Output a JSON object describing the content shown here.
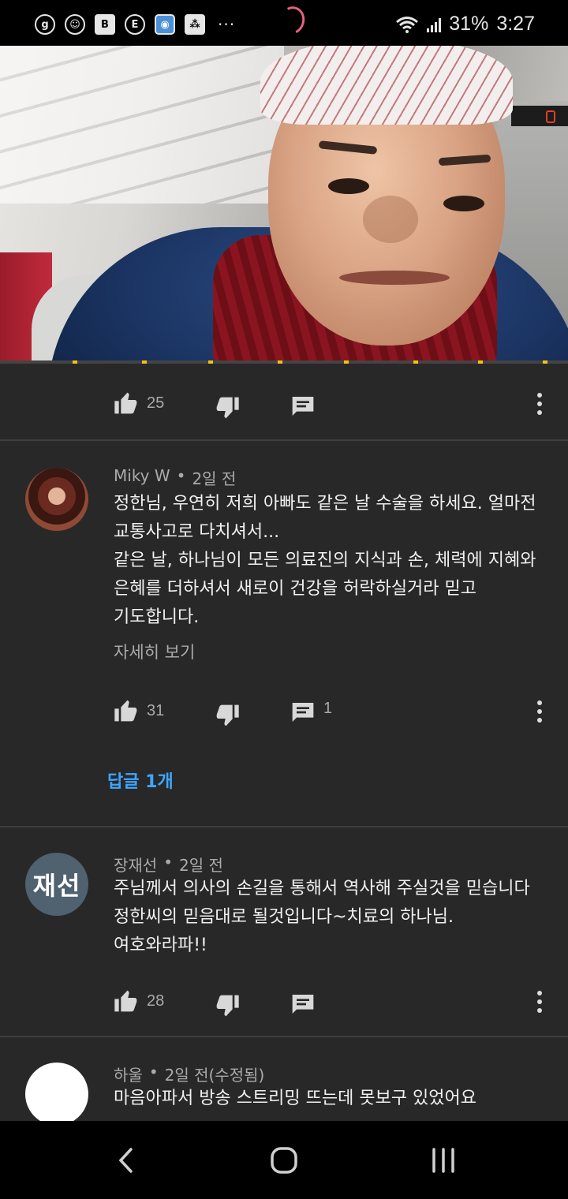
{
  "status_bar": {
    "left_icons": [
      "g-icon",
      "app-icon",
      "b-icon",
      "e-icon",
      "camera-icon",
      "game-icon"
    ],
    "left_glyphs": [
      "g",
      "☺",
      "B",
      "E",
      "◉",
      "⁂"
    ],
    "overflow": "···",
    "battery": "31%",
    "time": "3:27"
  },
  "video": {
    "progress_fraction": 0.0
  },
  "first_actions": {
    "likes": "25",
    "replies": ""
  },
  "comments": [
    {
      "author": "Miky W",
      "age": "2일 전",
      "avatar": "photo",
      "lines": [
        "정한님, 우연히 저희 아빠도 같은 날 수술을 하세요. 얼마전",
        "교통사고로 다치셔서...",
        "같은 날, 하나님이 모든 의료진의 지식과 손, 체력에 지혜와",
        "은혜를 더하셔서 새로이 건강을 허락하실거라 믿고",
        "기도합니다."
      ],
      "read_more": "자세히 보기",
      "likes": "31",
      "reply_count": "1",
      "replies_link": "답글 1개"
    },
    {
      "author": "장재선",
      "age": "2일 전",
      "avatar_initial": "재선",
      "lines": [
        "주님께서 의사의 손길을 통해서 역사해 주실것을 믿습니다",
        "정한씨의 믿음대로 될것입니다~치료의 하나님.",
        "여호와라파!!"
      ],
      "likes": "28"
    },
    {
      "author": "하울",
      "age": "2일 전(수정됨)",
      "lines": [
        "마음아파서 방송 스트리밍 뜨는데 못보구 있었어요"
      ]
    }
  ],
  "separator": "•",
  "colors": {
    "background": "#282828",
    "link": "#3ea6ff",
    "text_secondary": "#aaaaaa",
    "loader": "#e9627c"
  },
  "nav_bar": {
    "back": "back-icon",
    "home": "home-icon",
    "recents": "recents-icon"
  }
}
